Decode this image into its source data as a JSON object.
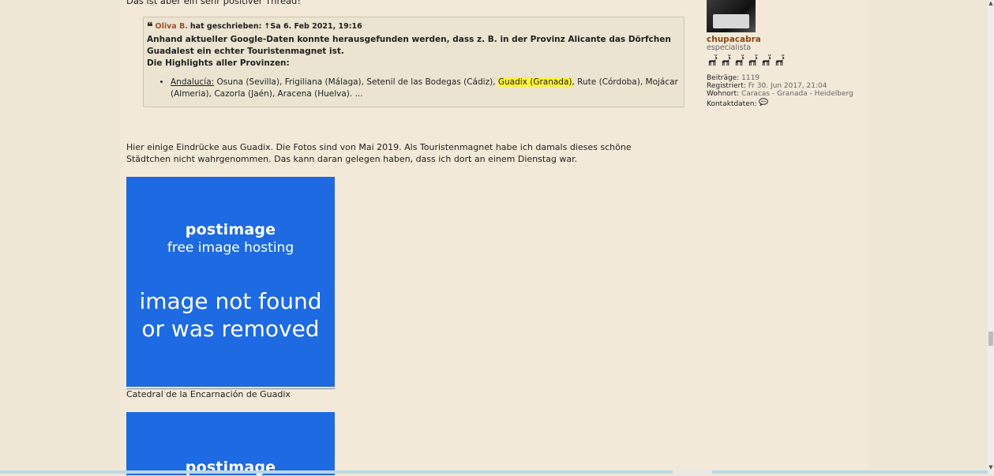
{
  "post": {
    "intro": "Das ist aber ein sehr positiver Thread!",
    "quote": {
      "author": "Oliva B.",
      "wrote": "hat geschrieben:",
      "date": "↑Sa 6. Feb 2021, 19:16",
      "text": "Anhand aktueller Google-Daten konnte herausgefunden werden, dass z. B. in der Provinz Alicante das Dörfchen Guadalest ein echter Touristenmagnet ist.",
      "highlights_heading": "Die Highlights aller Provinzen:",
      "list_region": "Andalucía:",
      "list_before": " Osuna (Sevilla), Frigiliana (Málaga), Setenil de las Bodegas (Cádiz), ",
      "list_highlight": "Guadix (Granada)",
      "list_after": ", Rute (Córdoba), Mojácar (Almeria), Cazorla (Jaén), Aracena (Huelva). ..."
    },
    "paragraph": "Hier einige Eindrücke aus Guadix. Die Fotos sind von Mai 2019. Als Touristenmagnet habe ich damals dieses schöne Städtchen nicht wahrgenommen. Das kann daran gelegen haben, dass ich dort an einem Dienstag war.",
    "image1": {
      "logo": "postimage",
      "sub": "free image hosting",
      "notfound_line1": "image not found",
      "notfound_line2": "or was removed"
    },
    "caption1": "Catedral de la Encarnación de Guadix",
    "image2": {
      "logo": "postimage"
    }
  },
  "profile": {
    "username": "chupacabra",
    "rank": "especialista",
    "goat_count": 6,
    "posts_label": "Beiträge:",
    "posts_value": "1119",
    "registered_label": "Registriert:",
    "registered_value": "Fr 30. Jun 2017, 21:04",
    "location_label": "Wohnort:",
    "location_value": "Caracas - Granada - Heidelberg",
    "contact_label": "Kontaktdaten:"
  },
  "colors": {
    "background": "#f3e9d8",
    "quote_bg": "#ebe4d1",
    "highlight": "#fff23a",
    "image_bg": "#1e6ae3",
    "username": "#8b4513"
  }
}
